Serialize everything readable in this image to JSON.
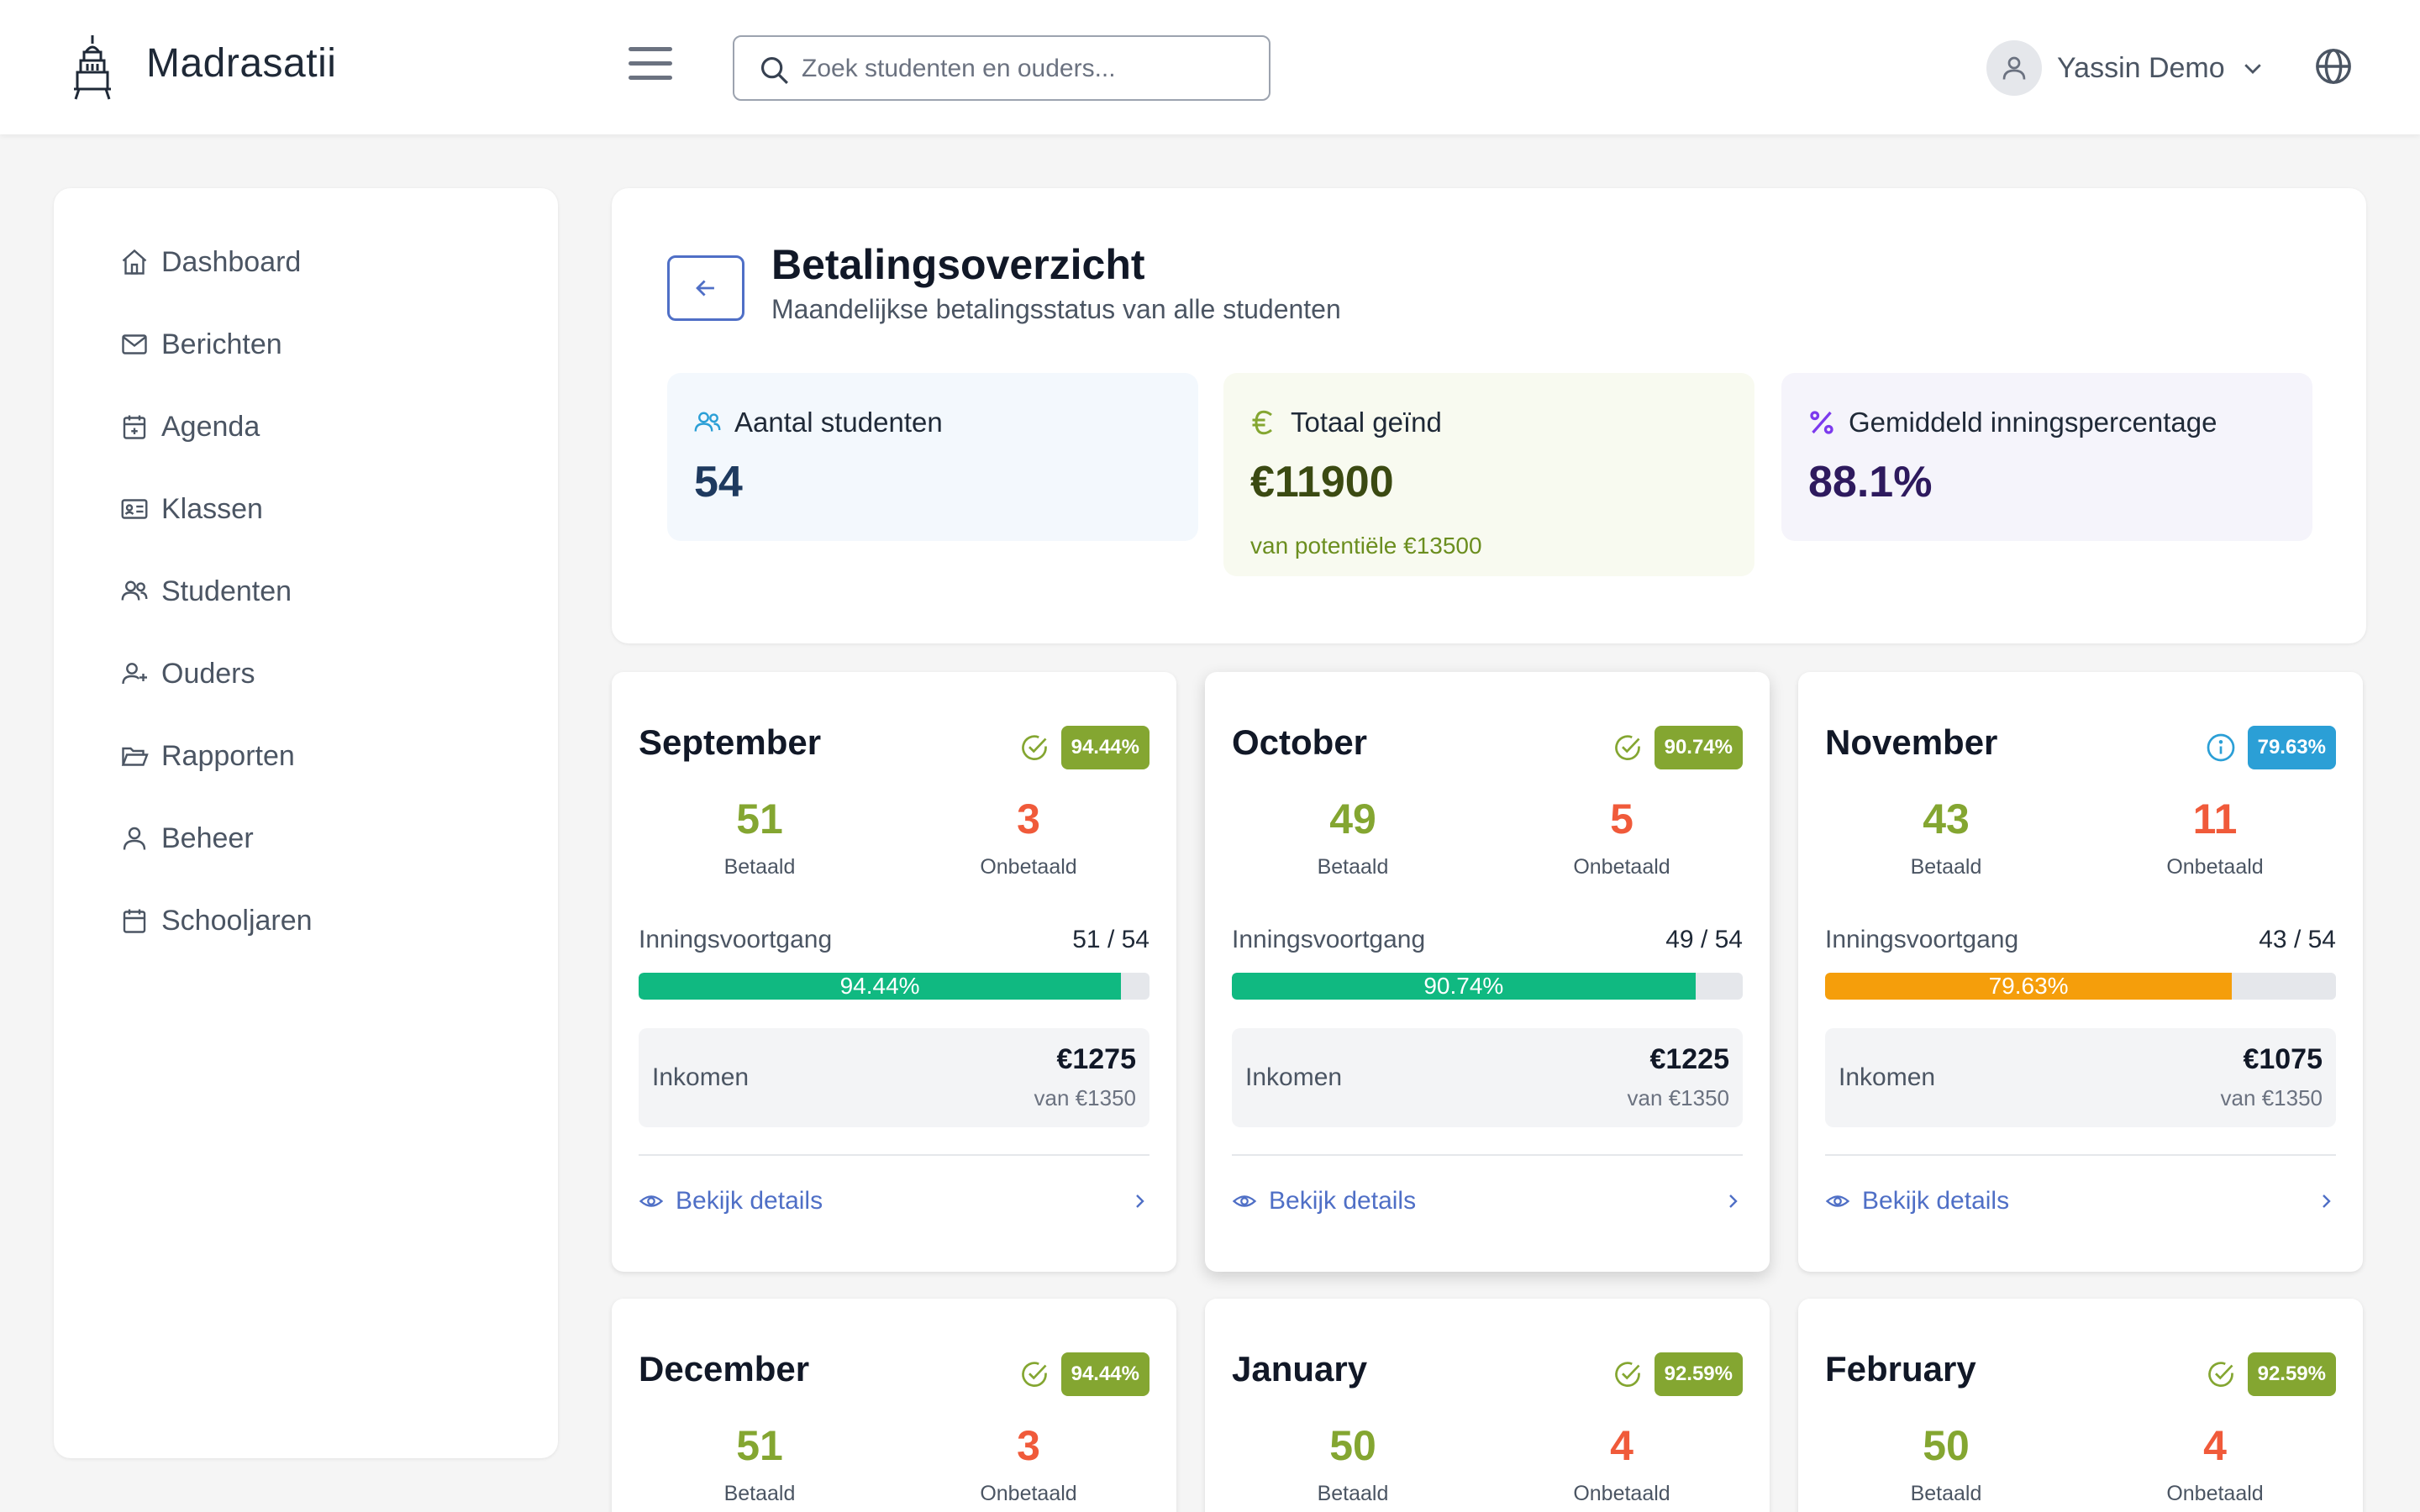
{
  "app": {
    "brand": "Madrasatii",
    "search_placeholder": "Zoek studenten en ouders...",
    "user_name": "Yassin Demo"
  },
  "sidebar": {
    "items": [
      {
        "label": "Dashboard",
        "icon": "home-icon"
      },
      {
        "label": "Berichten",
        "icon": "mail-icon"
      },
      {
        "label": "Agenda",
        "icon": "calendar-plus-icon"
      },
      {
        "label": "Klassen",
        "icon": "id-card-icon"
      },
      {
        "label": "Studenten",
        "icon": "users-icon"
      },
      {
        "label": "Ouders",
        "icon": "user-plus-icon"
      },
      {
        "label": "Rapporten",
        "icon": "folder-open-icon"
      },
      {
        "label": "Beheer",
        "icon": "user-icon"
      },
      {
        "label": "Schooljaren",
        "icon": "calendar-icon"
      }
    ]
  },
  "header": {
    "title": "Betalingsoverzicht",
    "subtitle": "Maandelijkse betalingsstatus van alle studenten"
  },
  "stats": {
    "students": {
      "label": "Aantal studenten",
      "value": "54"
    },
    "total": {
      "label": "Totaal geïnd",
      "value": "€11900",
      "sub": "van potentiële €13500"
    },
    "average": {
      "label": "Gemiddeld inningspercentage",
      "value": "88.1%"
    }
  },
  "labels": {
    "paid": "Betaald",
    "unpaid": "Onbetaald",
    "progress": "Inningsvoortgang",
    "income": "Inkomen",
    "details": "Bekijk details"
  },
  "colors": {
    "green_badge": "#84a631",
    "blue_badge": "#2b9fd6",
    "paid_text": "#84a631",
    "unpaid_text": "#f05a3a",
    "bar_green": "#10b981",
    "bar_orange": "#f59e0b",
    "accent": "#4f6fc6"
  },
  "months": [
    {
      "name": "September",
      "badge": "94.44%",
      "status": "ok",
      "paid": "51",
      "unpaid": "3",
      "count": "51 / 54",
      "fraction": 0.9444,
      "bar_text": "94.44%",
      "income": "€1275",
      "of": "van €1350"
    },
    {
      "name": "October",
      "badge": "90.74%",
      "status": "ok",
      "paid": "49",
      "unpaid": "5",
      "count": "49 / 54",
      "fraction": 0.9074,
      "bar_text": "90.74%",
      "income": "€1225",
      "of": "van €1350"
    },
    {
      "name": "November",
      "badge": "79.63%",
      "status": "info",
      "paid": "43",
      "unpaid": "11",
      "count": "43 / 54",
      "fraction": 0.7963,
      "bar_text": "79.63%",
      "income": "€1075",
      "of": "van €1350"
    },
    {
      "name": "December",
      "badge": "94.44%",
      "status": "ok",
      "paid": "51",
      "unpaid": "3"
    },
    {
      "name": "January",
      "badge": "92.59%",
      "status": "ok",
      "paid": "50",
      "unpaid": "4"
    },
    {
      "name": "February",
      "badge": "92.59%",
      "status": "ok",
      "paid": "50",
      "unpaid": "4"
    }
  ]
}
